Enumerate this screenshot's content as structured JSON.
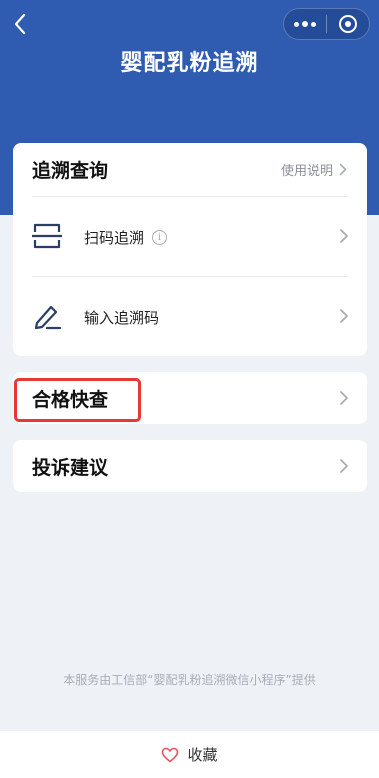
{
  "header": {
    "title": "婴配乳粉追溯",
    "back_icon": "chevron-left-icon",
    "menu_icon": "more-dots-icon",
    "close_icon": "target-circle-icon",
    "background_color": "#2f5bb0"
  },
  "trace_card": {
    "title": "追溯查询",
    "help_label": "使用说明",
    "items": [
      {
        "label": "扫码追溯",
        "icon": "scan-icon",
        "has_info": true
      },
      {
        "label": "输入追溯码",
        "icon": "pen-icon",
        "has_info": false
      }
    ]
  },
  "qualify_card": {
    "label": "合格快查",
    "highlight_color": "#e53935"
  },
  "complaint_card": {
    "label": "投诉建议"
  },
  "footer": {
    "note": "本服务由工信部“婴配乳粉追溯微信小程序”提供",
    "favorite_label": "收藏",
    "favorite_icon": "heart-icon"
  }
}
